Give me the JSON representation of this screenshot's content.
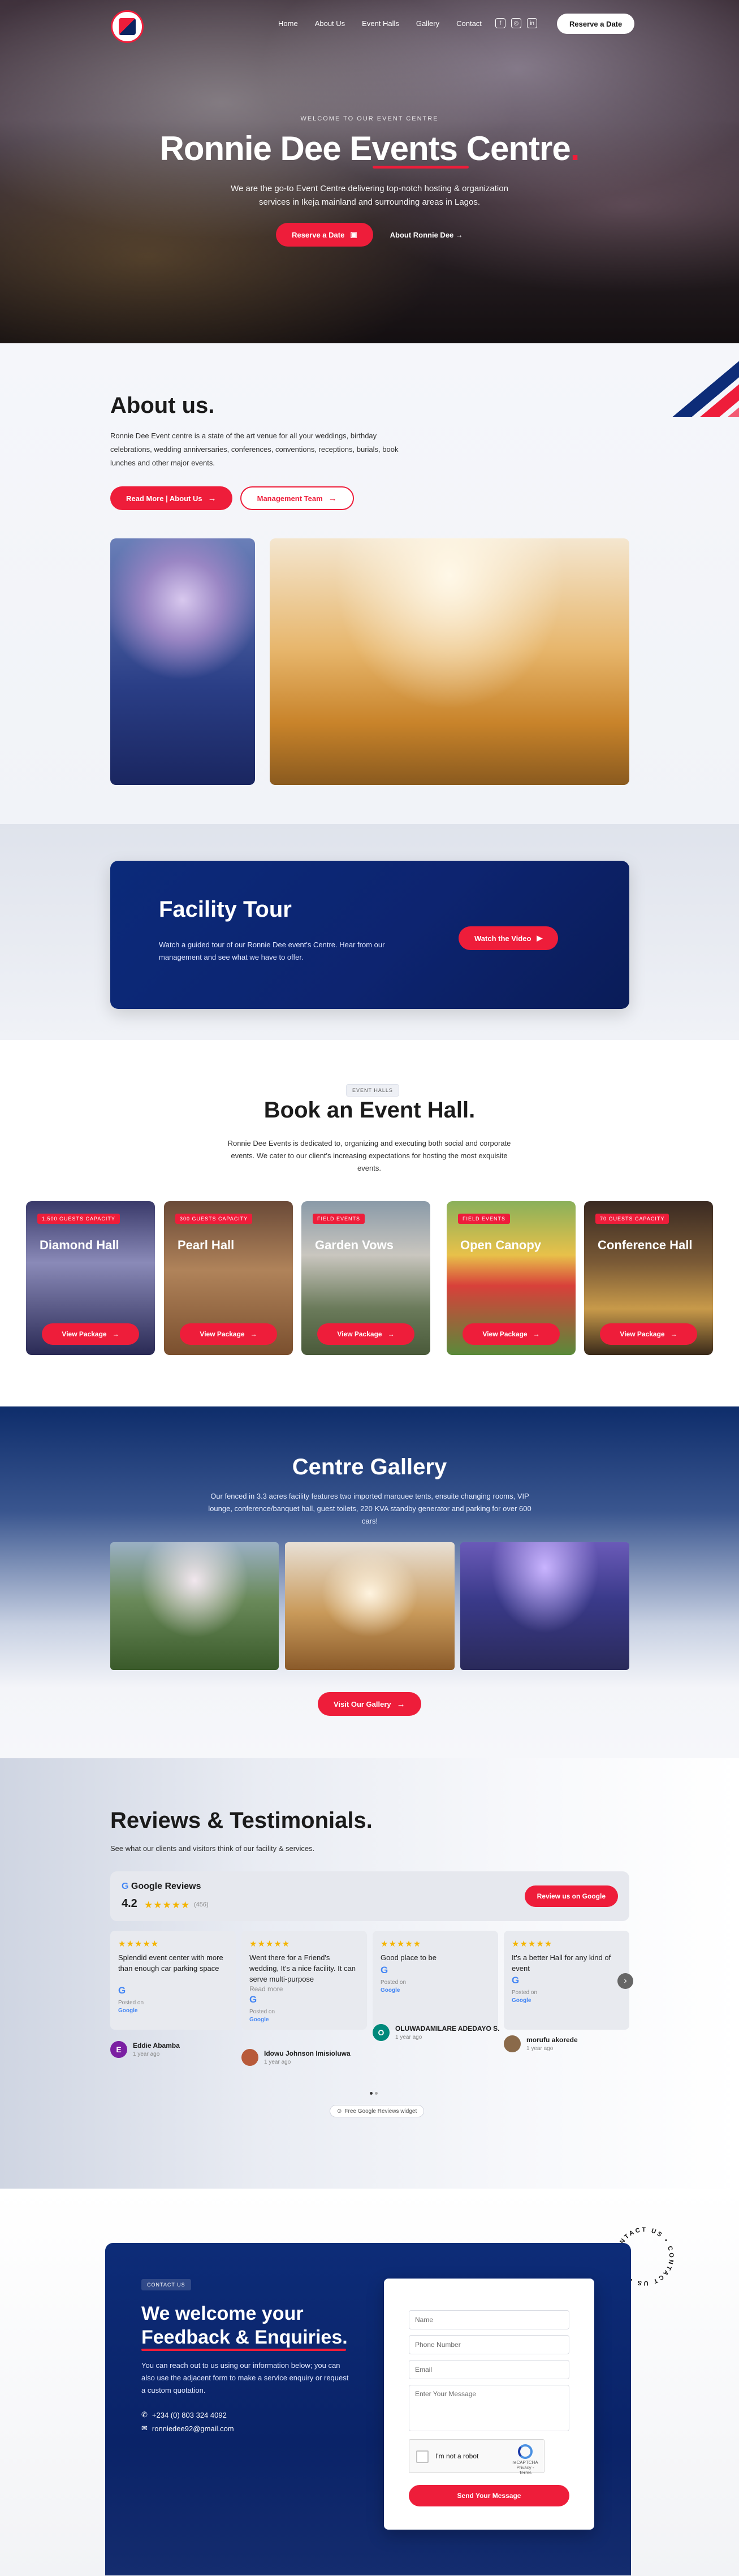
{
  "nav": {
    "links": [
      "Home",
      "About Us",
      "Event Halls",
      "Gallery",
      "Contact"
    ],
    "cta": "Reserve a Date",
    "social_icons": [
      "facebook-icon",
      "instagram-icon",
      "linkedin-icon"
    ]
  },
  "hero": {
    "kicker": "WELCOME TO OUR EVENT CENTRE",
    "title": "Ronnie Dee Events Centre",
    "title_dot": ".",
    "description": "We are the go-to Event Centre delivering top-notch hosting & organization services in Ikeja mainland and surrounding areas in Lagos.",
    "primary_btn": "Reserve a Date",
    "secondary_link": "About Ronnie Dee"
  },
  "about": {
    "title": "About us.",
    "text": "Ronnie Dee Event centre is a state of the art venue for all your weddings, birthday celebrations, wedding anniversaries, conferences, conventions, receptions, burials, book lunches and other major events.",
    "btn_primary": "Read More | About Us",
    "btn_secondary": "Management Team"
  },
  "facility": {
    "title": "Facility Tour",
    "description": "Watch a guided tour of our Ronnie Dee event's Centre. Hear from our management and see what we have to offer.",
    "button": "Watch the Video"
  },
  "halls": {
    "tag": "EVENT HALLS",
    "title": "Book an Event Hall.",
    "description": "Ronnie Dee Events is dedicated to, organizing and executing both social and corporate events. We cater to our client's increasing expectations for hosting the most exquisite events.",
    "items": [
      {
        "badge": "1,500 GUESTS CAPACITY",
        "name": "Diamond Hall",
        "button": "View Package"
      },
      {
        "badge": "300 GUESTS CAPACITY",
        "name": "Pearl Hall",
        "button": "View Package"
      },
      {
        "badge": "FIELD EVENTS",
        "name": "Garden Vows",
        "button": "View Package"
      },
      {
        "badge": "FIELD EVENTS",
        "name": "Open Canopy",
        "button": "View Package"
      },
      {
        "badge": "70 GUESTS CAPACITY",
        "name": "Conference Hall",
        "button": "View Package"
      }
    ]
  },
  "gallery": {
    "title": "Centre Gallery",
    "description": "Our fenced in 3.3 acres facility features two imported marquee tents, ensuite changing rooms, VIP lounge, conference/banquet hall, guest toilets, 220 KVA standby generator and parking for over 600 cars!",
    "button": "Visit Our Gallery"
  },
  "reviews": {
    "title": "Reviews & Testimonials.",
    "subtitle": "See what our clients and visitors think of our facility & services.",
    "google_label": "Google Reviews",
    "rating": "4.2",
    "count": "(456)",
    "review_btn": "Review us on Google",
    "posted_on": "Posted on",
    "posted_src": "Google",
    "free_widget": "Free Google Reviews widget",
    "cards": [
      {
        "text": "Splendid event center with more than enough car parking space",
        "name": "Eddie Abamba",
        "time": "1 year ago",
        "initial": "E",
        "read_more": ""
      },
      {
        "text": "Went there for a Friend's wedding, It's a nice facility. It can serve multi-purpose",
        "name": "Idowu Johnson Imisioluwa",
        "time": "1 year ago",
        "initial": "",
        "read_more": "Read more"
      },
      {
        "text": "Good place to be",
        "name": "OLUWADAMILARE ADEDAYO S.",
        "time": "1 year ago",
        "initial": "O",
        "read_more": ""
      },
      {
        "text": "It's a better Hall for any kind of event",
        "name": "morufu akorede",
        "time": "1 year ago",
        "initial": "",
        "read_more": ""
      }
    ]
  },
  "contact": {
    "tag": "CONTACT US",
    "title_line1": "We welcome your",
    "title_line2": "Feedback & Enquiries.",
    "description": "You can reach out to us using our information below; you can also use the adjacent form to make a service enquiry or request a custom quotation.",
    "phone": "+234 (0) 803 324 4092",
    "email": "ronniedee92@gmail.com",
    "form": {
      "name": "Name",
      "phone": "Phone Number",
      "email": "Email",
      "message": "Enter Your Message",
      "captcha": "I'm not a robot",
      "captcha_brand": "reCAPTCHA",
      "captcha_sub": "Privacy - Terms",
      "submit": "Send Your Message"
    },
    "badge_text": "CONTACT US • CONTACT US •"
  },
  "colors": {
    "accent": "#ee1d3a",
    "navy": "#0d2c78"
  }
}
